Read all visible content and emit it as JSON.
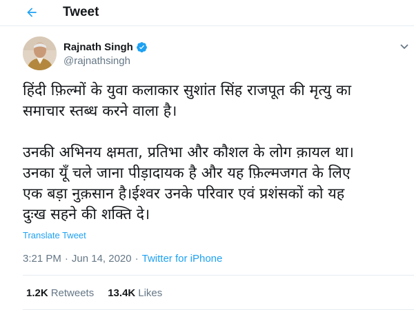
{
  "header": {
    "back_icon": "arrow-left-icon",
    "title": "Tweet"
  },
  "tweet": {
    "author": {
      "name": "Rajnath Singh",
      "handle": "@rajnathsingh",
      "verified_icon": "verified-badge-icon",
      "avatar_icon": "avatar"
    },
    "text": "हिंदी फ़िल्मों के युवा कलाकार सुशांत सिंह राजपूत की मृत्यु का\nसमाचार स्तब्ध करने वाला है।\n\nउनकी अभिनय क्षमता, प्रतिभा और कौशल के लोग क़ायल था।\nउनका यूँ चले जाना पीड़ादायक है और यह फ़िल्मजगत के लिए\nएक बड़ा नुक़सान है।ईश्वर उनके परिवार एवं प्रशंसकों को यह\nदुःख सहने की शक्ति दे।",
    "translate": "Translate Tweet",
    "time": "3:21 PM",
    "separator": "·",
    "date": "Jun 14, 2020",
    "source_separator": "·",
    "source": "Twitter for iPhone",
    "stats": {
      "retweets": {
        "count": "1.2K",
        "label": "Retweets"
      },
      "likes": {
        "count": "13.4K",
        "label": "Likes"
      }
    }
  },
  "colors": {
    "accent": "#1da1f2",
    "secondary_text": "#657786",
    "divider": "#e6ecf0"
  }
}
